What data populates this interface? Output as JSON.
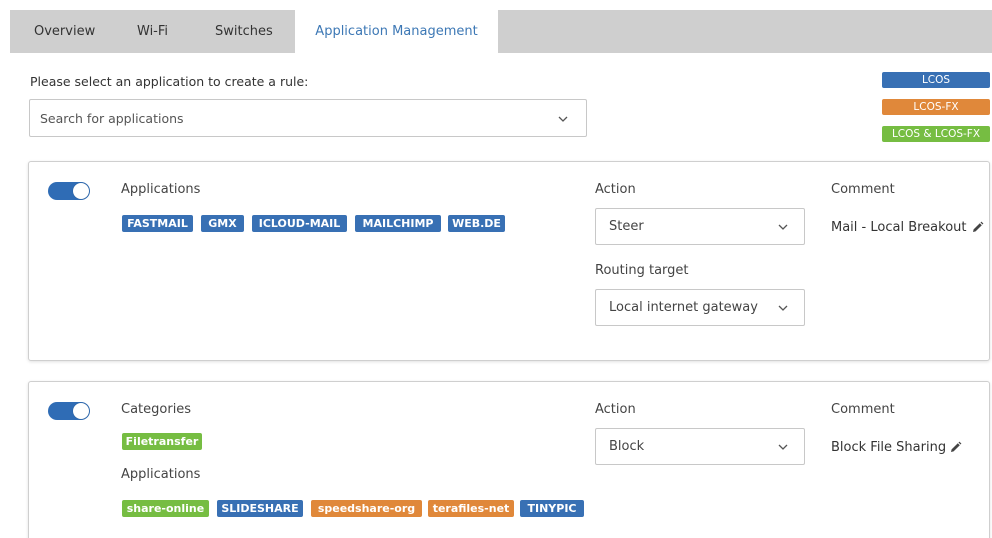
{
  "tabs": [
    {
      "label": "Overview"
    },
    {
      "label": "Wi-Fi"
    },
    {
      "label": "Switches"
    },
    {
      "label": "Application Management",
      "active": true
    }
  ],
  "prompt": "Please select an application to create a rule:",
  "search": {
    "placeholder": "Search for applications"
  },
  "legend": [
    {
      "label": "LCOS",
      "color": "#3870b4"
    },
    {
      "label": "LCOS-FX",
      "color": "#e0883a"
    },
    {
      "label": "LCOS & LCOS-FX",
      "color": "#76bd42"
    }
  ],
  "rules": [
    {
      "enabled": true,
      "applications_label": "Applications",
      "applications": [
        "FASTMAIL",
        "GMX",
        "ICLOUD-MAIL",
        "MAILCHIMP",
        "WEB.DE"
      ],
      "action_label": "Action",
      "action": "Steer",
      "routing_label": "Routing target",
      "routing_target": "Local internet gateway",
      "comment_label": "Comment",
      "comment": "Mail - Local Breakout"
    },
    {
      "enabled": true,
      "categories_label": "Categories",
      "categories": [
        "Filetransfer"
      ],
      "applications_label": "Applications",
      "applications": [
        "share-online",
        "SLIDESHARE",
        "speedshare-org",
        "terafiles-net",
        "TINYPIC"
      ],
      "action_label": "Action",
      "action": "Block",
      "comment_label": "Comment",
      "comment": "Block File Sharing"
    }
  ],
  "icons": {
    "dropdown": "chevron-down-icon",
    "edit": "pencil-icon"
  }
}
